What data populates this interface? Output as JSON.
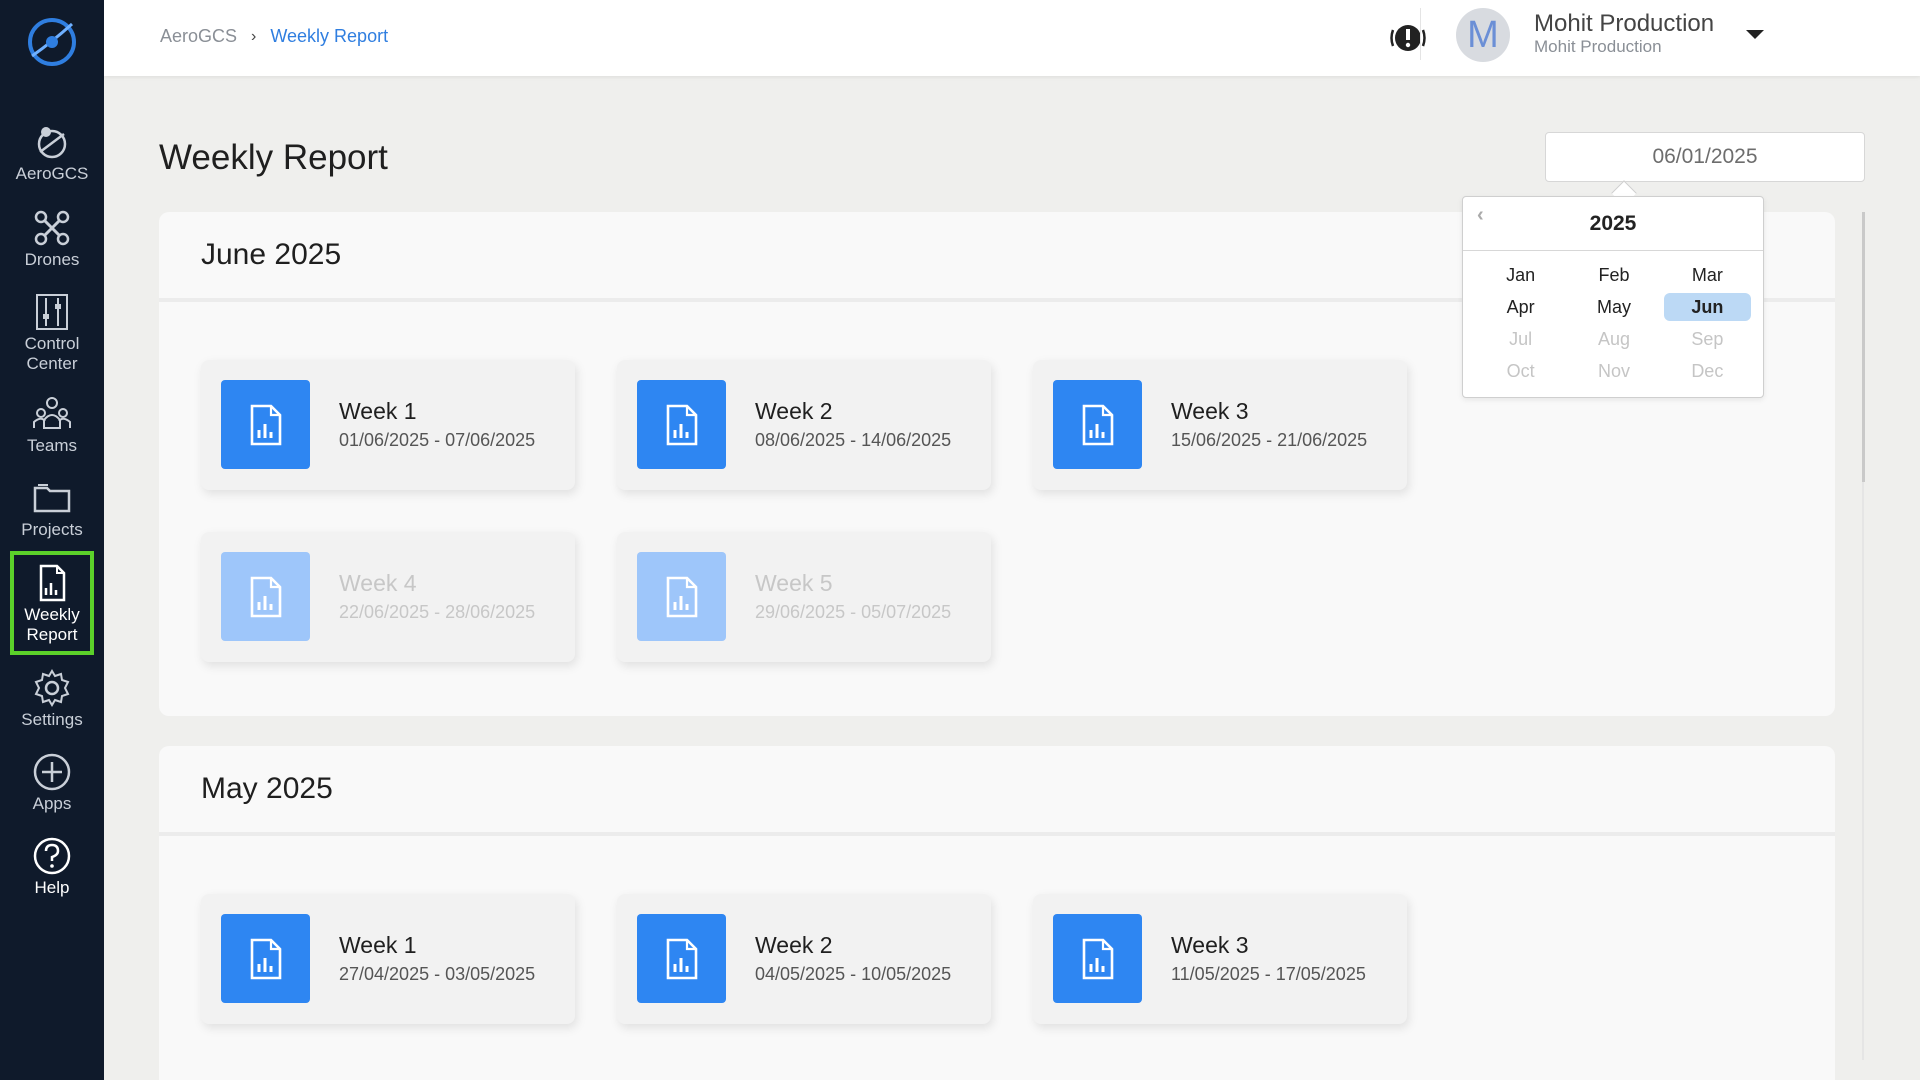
{
  "sidebar": {
    "items": [
      {
        "label": "AeroGCS",
        "icon": "aerogcs-icon"
      },
      {
        "label": "Drones",
        "icon": "drone-icon"
      },
      {
        "label": "Control Center",
        "icon": "sliders-icon"
      },
      {
        "label": "Teams",
        "icon": "team-icon"
      },
      {
        "label": "Projects",
        "icon": "folder-icon"
      },
      {
        "label": "Weekly Report",
        "icon": "report-icon",
        "active": true
      },
      {
        "label": "Settings",
        "icon": "gear-icon"
      },
      {
        "label": "Apps",
        "icon": "plus-circle-icon"
      },
      {
        "label": "Help",
        "icon": "help-icon"
      }
    ]
  },
  "header": {
    "breadcrumb": [
      "AeroGCS",
      "Weekly Report"
    ],
    "user_initial": "M",
    "user_name": "Mohit Production",
    "user_org": "Mohit Production"
  },
  "page": {
    "title": "Weekly Report",
    "date_value": "06/01/2025"
  },
  "picker": {
    "year": "2025",
    "months": [
      "Jan",
      "Feb",
      "Mar",
      "Apr",
      "May",
      "Jun",
      "Jul",
      "Aug",
      "Sep",
      "Oct",
      "Nov",
      "Dec"
    ],
    "selected": "Jun"
  },
  "sections": [
    {
      "title": "June 2025",
      "weeks": [
        {
          "title": "Week 1",
          "range": "01/06/2025 - 07/06/2025",
          "enabled": true
        },
        {
          "title": "Week 2",
          "range": "08/06/2025 - 14/06/2025",
          "enabled": true
        },
        {
          "title": "Week 3",
          "range": "15/06/2025 - 21/06/2025",
          "enabled": true
        },
        {
          "title": "Week 4",
          "range": "22/06/2025 - 28/06/2025",
          "enabled": false
        },
        {
          "title": "Week 5",
          "range": "29/06/2025 - 05/07/2025",
          "enabled": false
        }
      ]
    },
    {
      "title": "May 2025",
      "weeks": [
        {
          "title": "Week 1",
          "range": "27/04/2025 - 03/05/2025",
          "enabled": true
        },
        {
          "title": "Week 2",
          "range": "04/05/2025 - 10/05/2025",
          "enabled": true
        },
        {
          "title": "Week 3",
          "range": "11/05/2025 - 17/05/2025",
          "enabled": true
        }
      ]
    }
  ],
  "colors": {
    "accent": "#2e86f2",
    "active_border": "#5bd12a",
    "sidebar_bg": "#0f1a2b"
  }
}
